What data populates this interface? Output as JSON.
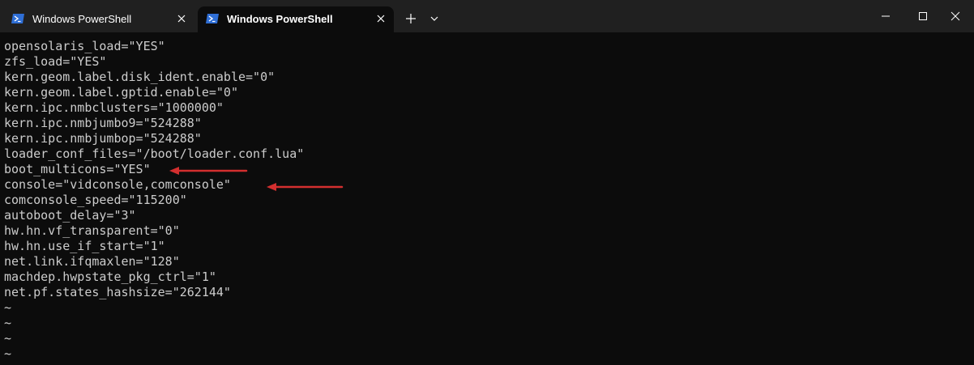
{
  "tabs": [
    {
      "title": "Windows PowerShell",
      "icon": "powershell-icon"
    },
    {
      "title": "Windows PowerShell",
      "icon": "powershell-icon"
    }
  ],
  "active_tab": 1,
  "colors": {
    "terminal_bg": "#0c0c0c",
    "terminal_fg": "#cccccc",
    "titlebar_bg": "#202020",
    "annotation_arrow": "#d32f2f",
    "powershell_icon": "#2f6fd6"
  },
  "terminal": {
    "lines": [
      "opensolaris_load=\"YES\"",
      "zfs_load=\"YES\"",
      "kern.geom.label.disk_ident.enable=\"0\"",
      "kern.geom.label.gptid.enable=\"0\"",
      "kern.ipc.nmbclusters=\"1000000\"",
      "kern.ipc.nmbjumbo9=\"524288\"",
      "kern.ipc.nmbjumbop=\"524288\"",
      "loader_conf_files=\"/boot/loader.conf.lua\"",
      "boot_multicons=\"YES\"",
      "console=\"vidconsole,comconsole\"",
      "comconsole_speed=\"115200\"",
      "autoboot_delay=\"3\"",
      "hw.hn.vf_transparent=\"0\"",
      "hw.hn.use_if_start=\"1\"",
      "net.link.ifqmaxlen=\"128\"",
      "machdep.hwpstate_pkg_ctrl=\"1\"",
      "net.pf.states_hashsize=\"262144\"",
      "~",
      "~",
      "~",
      "~"
    ]
  }
}
